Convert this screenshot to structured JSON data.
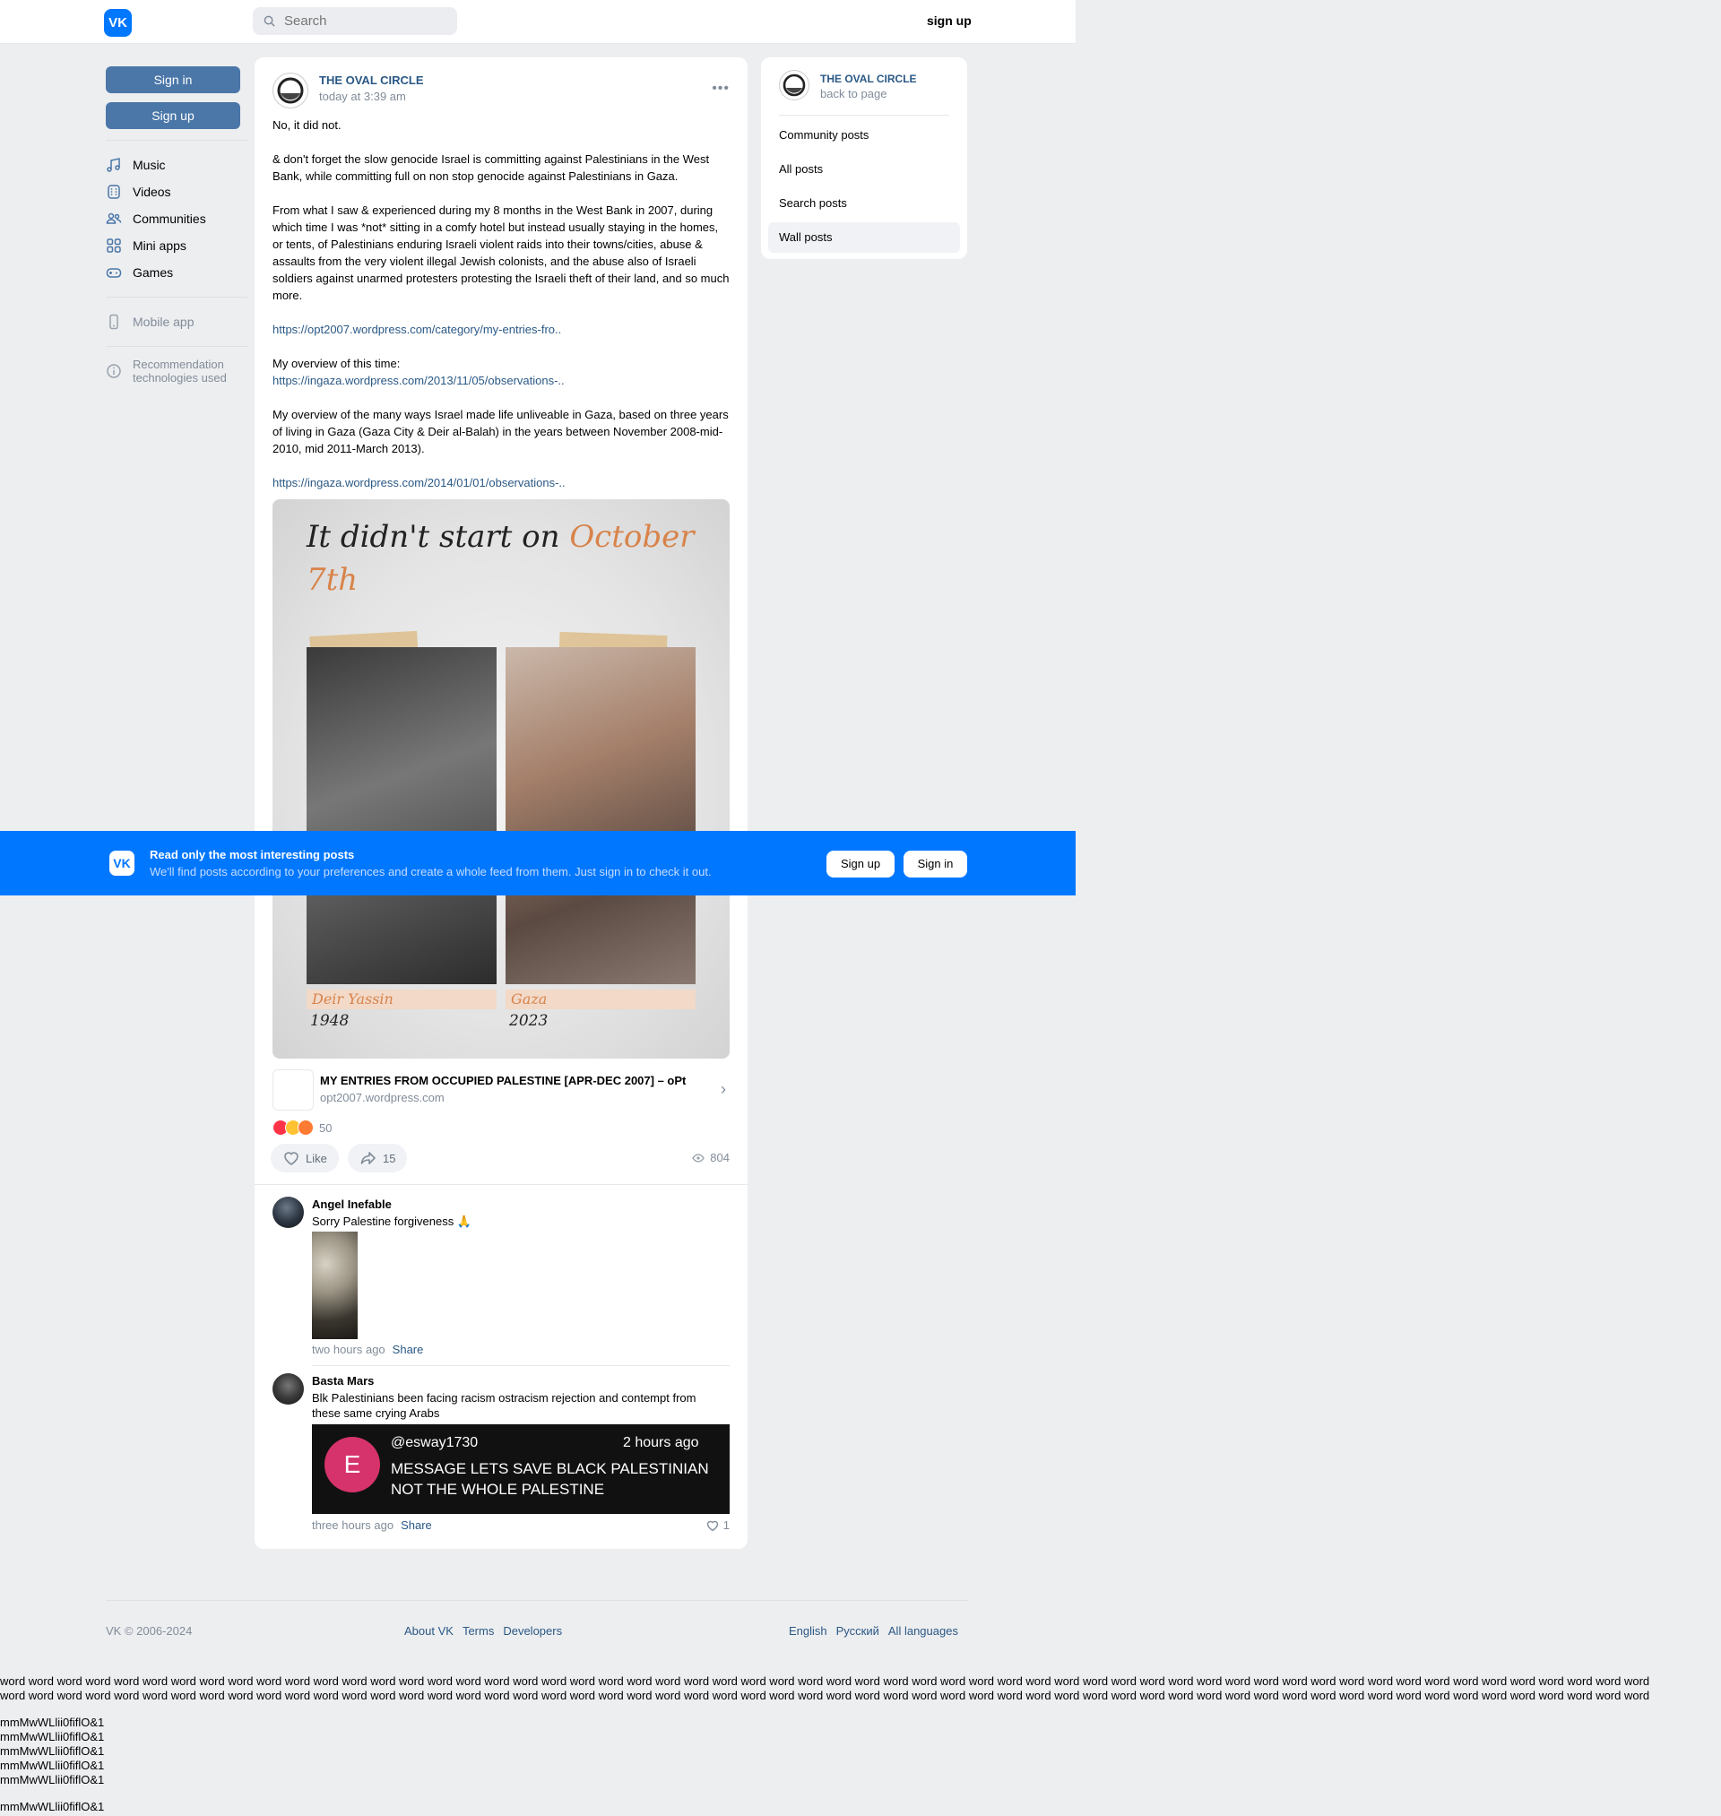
{
  "header": {
    "logo": "VK",
    "search_placeholder": "Search",
    "signup_link": "sign up"
  },
  "left": {
    "sign_in": "Sign in",
    "sign_up": "Sign up",
    "nav": [
      {
        "label": "Music",
        "icon": "music-icon"
      },
      {
        "label": "Videos",
        "icon": "videos-icon"
      },
      {
        "label": "Communities",
        "icon": "communities-icon"
      },
      {
        "label": "Mini apps",
        "icon": "mini-apps-icon"
      },
      {
        "label": "Games",
        "icon": "games-icon"
      }
    ],
    "mobile_app": "Mobile app",
    "recommendation": "Recommendation technologies used"
  },
  "post": {
    "author": "THE OVAL CIRCLE",
    "date": "today at 3:39 am",
    "paragraphs": [
      "No, it did not.",
      "& don't forget the slow genocide Israel is committing against Palestinians in the West Bank, while committing full on non stop genocide against Palestinians in Gaza.",
      "From what I saw & experienced during my 8 months in the West Bank in 2007, during which time I was *not* sitting in a comfy hotel but instead usually staying in the homes, or tents, of Palestinians enduring Israeli violent raids into their towns/cities, abuse & assaults from the very violent illegal Jewish colonists, and the abuse also of Israeli soldiers against unarmed protesters protesting the Israeli theft of their land, and so much more."
    ],
    "link1": "https://opt2007.wordpress.com/category/my-entries-fro..",
    "overview1_label": "My overview of this time:",
    "link2": "https://ingaza.wordpress.com/2013/11/05/observations-..",
    "paragraph4": "My overview of the many ways Israel made life unliveable in Gaza, based on three years of living in Gaza (Gaza City & Deir al-Balah) in the years between November 2008-mid-2010, mid 2011-March 2013).",
    "link3": "https://ingaza.wordpress.com/2014/01/01/observations-..",
    "image": {
      "title_a": "It didn't start on ",
      "title_b": "October",
      "title_c": "7th",
      "caption_left": "Deir Yassin",
      "year_left": "1948",
      "caption_right": "Gaza",
      "year_right": "2023"
    },
    "link_snippet": {
      "title": "MY ENTRIES FROM OCCUPIED PALESTINE [APR-DEC 2007] – oPt",
      "host": "opt2007.wordpress.com"
    },
    "reactions_count": "50",
    "like_label": "Like",
    "shares": "15",
    "views": "804"
  },
  "comments": [
    {
      "name": "Angel Inefable",
      "text": "Sorry Palestine forgiveness 🙏",
      "time": "two hours ago",
      "share": "Share"
    },
    {
      "name": "Basta Mars",
      "text": "Blk Palestinians been facing racism ostracism rejection and contempt from these same crying Arabs",
      "embed": {
        "avatar_letter": "E",
        "handle": "@esway1730",
        "time": "2 hours ago",
        "message": "MESSAGE LETS SAVE BLACK PALESTINIAN NOT THE WHOLE PALESTINE"
      },
      "time": "three hours ago",
      "share": "Share",
      "likes": "1"
    }
  ],
  "banner": {
    "logo": "VK",
    "title": "Read only the most interesting posts",
    "subtitle": "We'll find posts according to your preferences and create a whole feed from them. Just sign in to check it out.",
    "sign_up": "Sign up",
    "sign_in": "Sign in"
  },
  "right": {
    "title": "THE OVAL CIRCLE",
    "back": "back to page",
    "items": [
      "Community posts",
      "All posts",
      "Search posts",
      "Wall posts"
    ]
  },
  "footer": {
    "copyright": "VK © 2006-2024",
    "about": "About VK",
    "terms": "Terms",
    "developers": "Developers",
    "english": "English",
    "russian": "Русский",
    "all_languages": "All languages"
  },
  "probe": {
    "words": "word word word word word word word word word word word word word word word word word word word word word word word word word word word word word word word word word word word word word word word word word word word word word word word word word word word word word word word word word word",
    "glyphs": "mmMwWLlii0fiflO&1"
  },
  "colors": {
    "vk_blue": "#0077ff",
    "button_blue": "#4a76a8",
    "link": "#2a5885",
    "muted": "#818c99",
    "background": "#edeef0"
  }
}
